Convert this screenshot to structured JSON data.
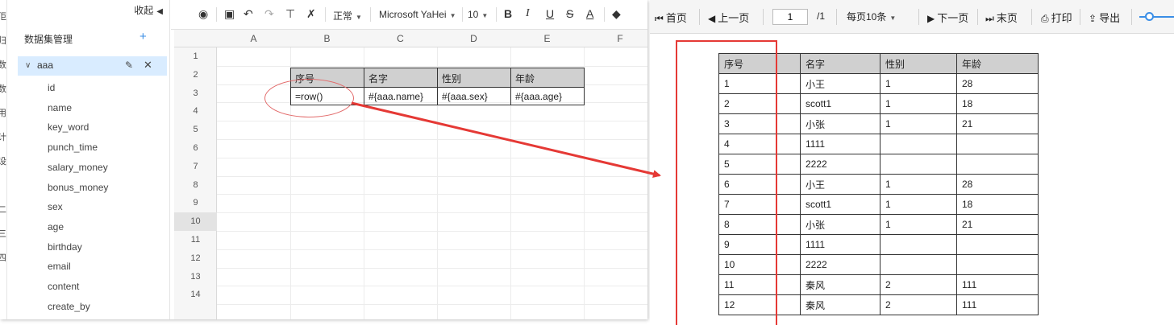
{
  "left_peek_chars": [
    "佢",
    "归",
    "数",
    "数",
    "用",
    "计",
    "设",
    "二",
    "三",
    "四"
  ],
  "panel": {
    "collapse_label": "收起",
    "title": "数据集管理",
    "add_symbol": "+",
    "dataset": {
      "name": "aaa"
    },
    "fields": [
      "id",
      "name",
      "key_word",
      "punch_time",
      "salary_money",
      "bonus_money",
      "sex",
      "age",
      "birthday",
      "email",
      "content",
      "create_by"
    ]
  },
  "toolbar": {
    "font_style": "正常",
    "font_family": "Microsoft YaHei",
    "font_size": "10",
    "bold": "B",
    "italic": "I",
    "underline": "U",
    "strike": "S",
    "font_color": "A"
  },
  "sheet": {
    "columns": [
      "A",
      "B",
      "C",
      "D",
      "E",
      "F"
    ],
    "rows": [
      "1",
      "2",
      "3",
      "4",
      "5",
      "6",
      "7",
      "8",
      "9",
      "10",
      "11",
      "12",
      "13",
      "14"
    ],
    "selected_row": "10",
    "header_cells": [
      "序号",
      "名字",
      "性别",
      "年龄"
    ],
    "template_cells": [
      "=row()",
      "#{aaa.name}",
      "#{aaa.sex}",
      "#{aaa.age}"
    ]
  },
  "preview": {
    "first": "首页",
    "prev": "上一页",
    "page": "1",
    "total": "/1",
    "per_page": "每页10条",
    "next": "下一页",
    "last": "末页",
    "print": "打印",
    "export": "导出",
    "table": {
      "headers": [
        "序号",
        "名字",
        "性别",
        "年龄"
      ],
      "rows": [
        [
          "1",
          "小王",
          "1",
          "28"
        ],
        [
          "2",
          "scott1",
          "1",
          "18"
        ],
        [
          "3",
          "小张",
          "1",
          "21"
        ],
        [
          "4",
          "1111",
          "",
          ""
        ],
        [
          "5",
          "2222",
          "",
          ""
        ],
        [
          "6",
          "小王",
          "1",
          "28"
        ],
        [
          "7",
          "scott1",
          "1",
          "18"
        ],
        [
          "8",
          "小张",
          "1",
          "21"
        ],
        [
          "9",
          "1111",
          "",
          ""
        ],
        [
          "10",
          "2222",
          "",
          ""
        ],
        [
          "11",
          "秦风",
          "2",
          "111"
        ],
        [
          "12",
          "秦风",
          "2",
          "111"
        ]
      ]
    }
  },
  "colors": {
    "annotation_red": "#e53935",
    "accent_blue": "#3a8ee6",
    "header_gray": "#d0d0d0"
  }
}
